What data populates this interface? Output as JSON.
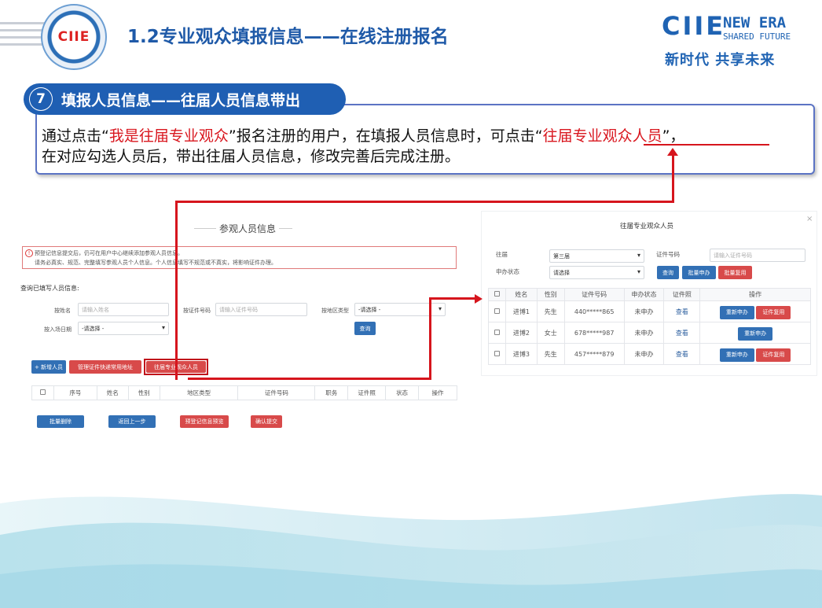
{
  "header": {
    "logo_text": "CIIE",
    "title": "1.2专业观众填报信息——在线注册报名",
    "brand_ciie": "CIIE",
    "brand_new_era": "NEW ERA",
    "brand_shared": "SHARED FUTURE",
    "brand_cn": "新时代 共享未来"
  },
  "step": {
    "number": "7",
    "label": "填报人员信息——往届人员信息带出"
  },
  "description": {
    "l1_a": "通过点击“",
    "l1_red": "我是往届专业观众",
    "l1_b": "”报名注册的用户，在填报人员信息时，可点击“",
    "l1_red2": "往届专业观众人员",
    "l1_c": "”，",
    "l2": "在对应勾选人员后，带出往届人员信息，修改完善后完成注册。"
  },
  "left": {
    "section_title": "参观人员信息",
    "notice_line1": "预登记信息提交后，仍可在用户中心继续添加参观人员信息。",
    "notice_line2": "请务必真实、规范、完整填写参观人员个人信息。个人信息填写不规范或不真实，将影响证件办理。",
    "query_title": "查询已填写人员信息:",
    "by_name": "按姓名",
    "by_name_ph": "请输入姓名",
    "by_id": "按证件号码",
    "by_id_ph": "请输入证件号码",
    "by_region": "按地区类型",
    "region_value": "-请选择 -",
    "by_date": "按入场日期",
    "date_value": "-请选择 -",
    "query_btn": "查询",
    "add_btn": "+ 新增人员",
    "manage_btn": "管理证件快递常用地址",
    "past_btn": "往届专业观众人员",
    "columns": [
      "",
      "序号",
      "姓名",
      "性别",
      "地区类型",
      "证件号码",
      "职务",
      "证件照",
      "状态",
      "操作"
    ],
    "batch_delete": "批量删除",
    "back": "返回上一步",
    "preview": "预登记信息预览",
    "submit": "确认提交"
  },
  "right": {
    "title": "往届专业观众人员",
    "close": "×",
    "session_label": "往届",
    "session_value": "第三届",
    "id_label": "证件号码",
    "id_ph": "请输入证件号码",
    "status_label": "申办状态",
    "status_value": "请选择",
    "query": "查询",
    "batch_apply": "批量申办",
    "batch_reuse": "批量复用",
    "columns": [
      "",
      "姓名",
      "性别",
      "证件号码",
      "申办状态",
      "证件照",
      "操作"
    ],
    "rows": [
      {
        "name": "进博1",
        "gender": "先生",
        "id": "440*****865",
        "status": "未申办",
        "photo": "查看",
        "actions": [
          "重新申办",
          "证件复用"
        ]
      },
      {
        "name": "进博2",
        "gender": "女士",
        "id": "678*****987",
        "status": "未申办",
        "photo": "查看",
        "actions": [
          "重新申办"
        ]
      },
      {
        "name": "进博3",
        "gender": "先生",
        "id": "457*****879",
        "status": "未申办",
        "photo": "查看",
        "actions": [
          "重新申办",
          "证件复用"
        ]
      }
    ]
  },
  "colors": {
    "primary": "#1f5fb3",
    "accent_red": "#d9171f",
    "button_blue": "#3270b5",
    "button_red": "#d84a4a"
  }
}
